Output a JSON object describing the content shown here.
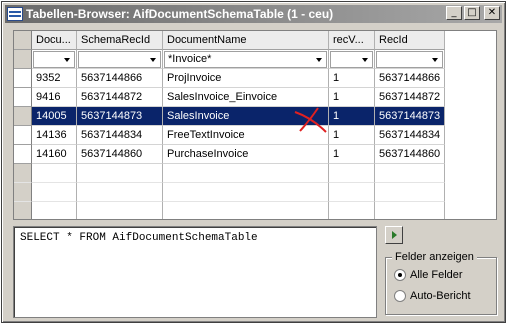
{
  "window": {
    "title": "Tabellen-Browser: AifDocumentSchemaTable (1 - ceu)",
    "minimize_glyph": "_",
    "maximize_glyph": "□",
    "close_glyph": "✕"
  },
  "grid": {
    "columns": [
      "Docu...",
      "SchemaRecId",
      "DocumentName",
      "recV...",
      "RecId"
    ],
    "filters": [
      "",
      "",
      "*Invoice*",
      "",
      ""
    ],
    "rows": [
      [
        "9352",
        "5637144866",
        "ProjInvoice",
        "1",
        "5637144866"
      ],
      [
        "9416",
        "5637144872",
        "SalesInvoice_Einvoice",
        "1",
        "5637144872"
      ],
      [
        "14005",
        "5637144873",
        "SalesInvoice",
        "1",
        "5637144873"
      ],
      [
        "14136",
        "5637144834",
        "FreeTextInvoice",
        "1",
        "5637144834"
      ],
      [
        "14160",
        "5637144860",
        "PurchaseInvoice",
        "1",
        "5637144860"
      ]
    ],
    "selected_row_index": 2
  },
  "query": {
    "sql": "SELECT * FROM AifDocumentSchemaTable"
  },
  "field_options": {
    "legend": "Felder anzeigen",
    "options": [
      "Alle Felder",
      "Auto-Bericht"
    ],
    "selected": "Alle Felder"
  },
  "annotation": {
    "color": "#e02020"
  }
}
